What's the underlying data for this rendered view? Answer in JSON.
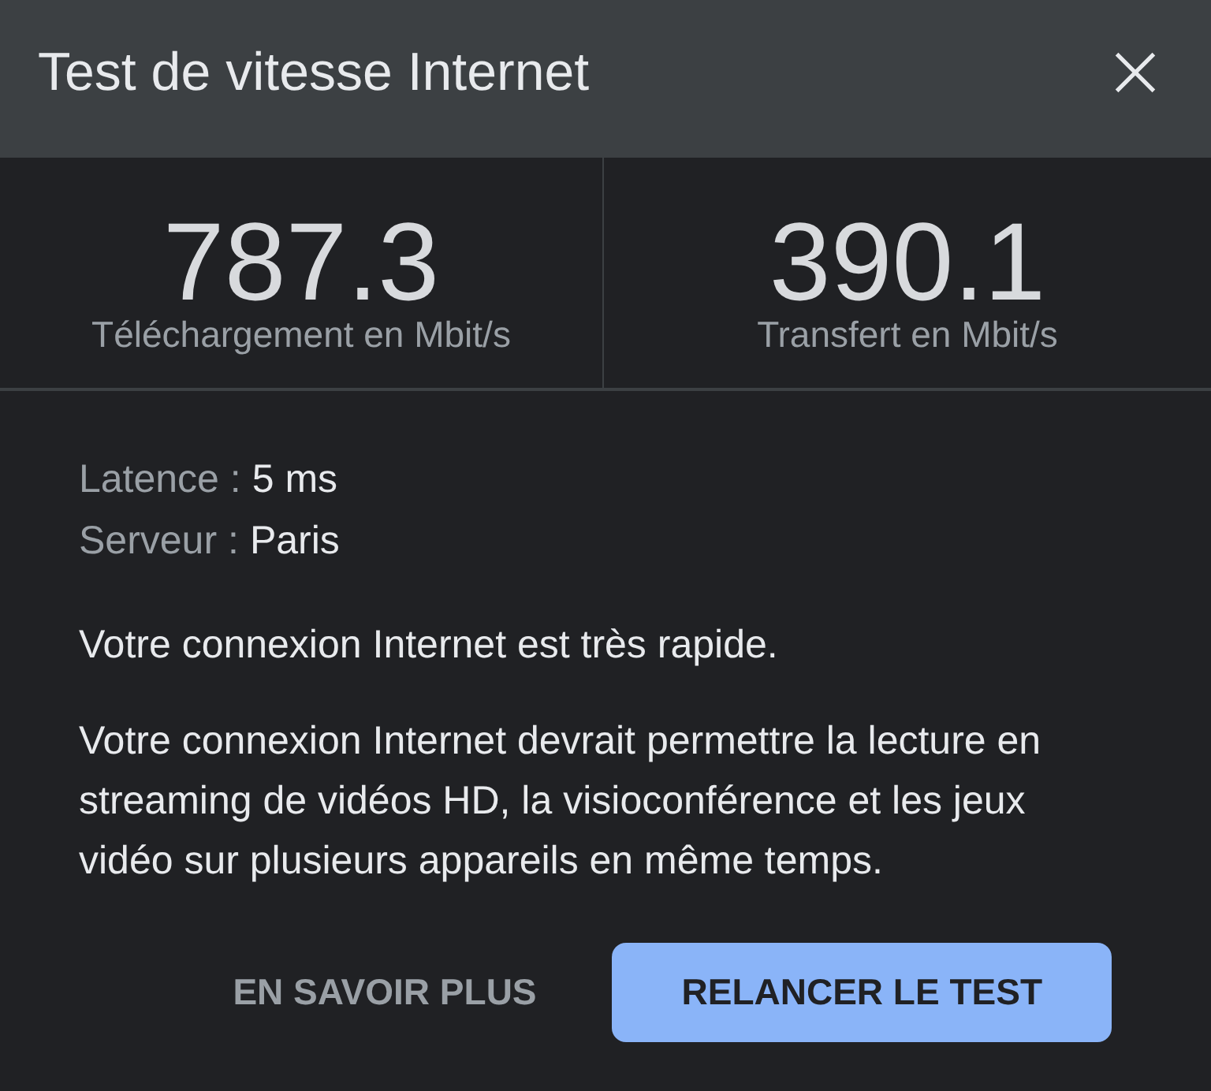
{
  "dialog": {
    "title": "Test de vitesse Internet"
  },
  "results": [
    {
      "value": "787.3",
      "label": "Téléchargement en Mbit/s"
    },
    {
      "value": "390.1",
      "label": "Transfert en Mbit/s"
    }
  ],
  "details": [
    {
      "label": "Latence :",
      "value": "5 ms"
    },
    {
      "label": "Serveur :",
      "value": "Paris"
    }
  ],
  "messages": [
    "Votre connexion Internet est très rapide.",
    "Votre connexion Internet devrait permettre la lecture en streaming de vidéos HD, la visioconférence et les jeux vidéo sur plusieurs appareils en même temps."
  ],
  "actions": [
    {
      "label": "EN SAVOIR PLUS",
      "kind": "text"
    },
    {
      "label": "RELANCER LE TEST",
      "kind": "filled"
    }
  ]
}
